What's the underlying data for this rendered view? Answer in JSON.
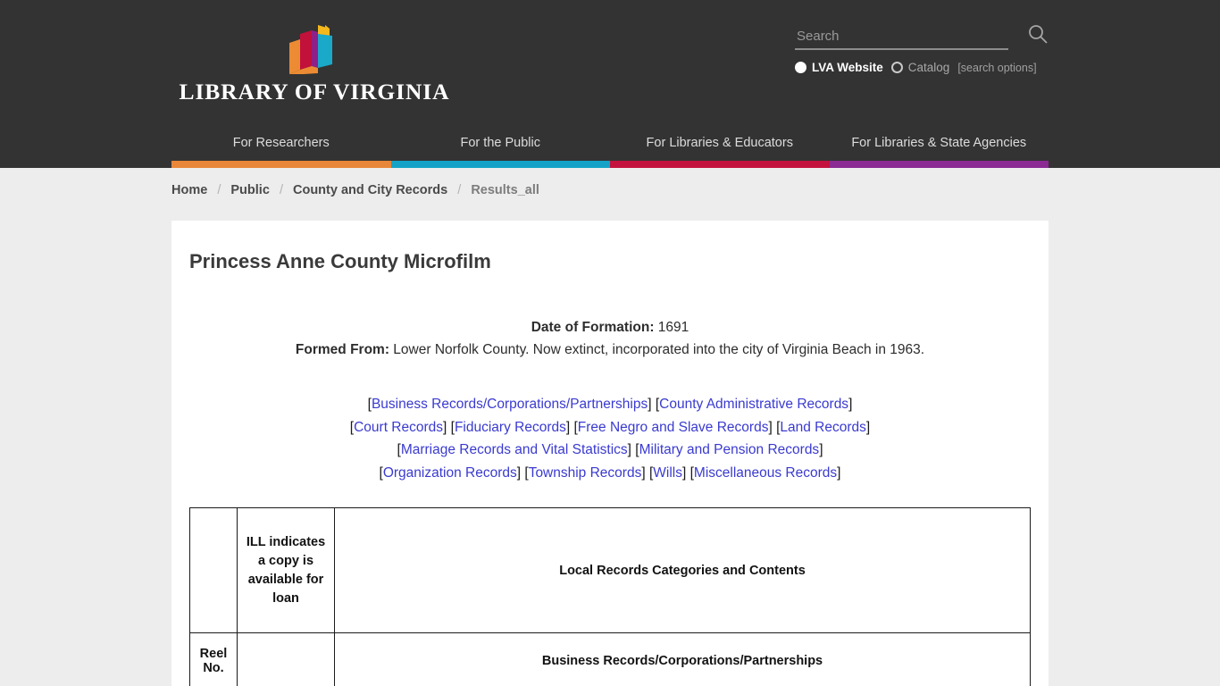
{
  "header": {
    "brand": {
      "wordmark": "LIBRARY OF VIRGINIA",
      "logo_icon": "open-book-logo-icon",
      "colors": {
        "orange": "#ec8b33",
        "crimson": "#c2113a",
        "purple": "#8e2088",
        "yellow": "#f5b81c",
        "cyan": "#1aa9c8"
      }
    },
    "search": {
      "placeholder": "Search",
      "value": "",
      "submit_icon": "search-icon",
      "scopes": [
        {
          "label": "LVA Website",
          "selected": true
        },
        {
          "label": "Catalog",
          "selected": false
        }
      ],
      "options_link": "[search options]"
    },
    "nav": {
      "items": [
        {
          "label": "For Researchers",
          "accent": "#e8873a"
        },
        {
          "label": "For the Public",
          "accent": "#14a3c7"
        },
        {
          "label": "For Libraries & Educators",
          "accent": "#c4123e"
        },
        {
          "label": "For Libraries & State Agencies",
          "accent": "#8b2a93"
        }
      ]
    },
    "background_color": "#333333"
  },
  "breadcrumb": {
    "separator": "/",
    "items": [
      {
        "label": "Home",
        "current": false
      },
      {
        "label": "Public",
        "current": false
      },
      {
        "label": "County and City Records",
        "current": false
      },
      {
        "label": "Results_all",
        "current": true
      }
    ]
  },
  "main": {
    "page_title": "Princess Anne County Microfilm",
    "meta": {
      "formation_label": "Date of Formation:",
      "formation_value": "1691",
      "formed_from_label": "Formed From:",
      "formed_from_value": "Lower Norfolk County. Now extinct, incorporated into the city of Virginia Beach in 1963."
    },
    "category_links": [
      "Business Records/Corporations/Partnerships",
      "County Administrative Records",
      "Court Records",
      "Fiduciary Records",
      "Free Negro and Slave Records",
      "Land Records",
      "Marriage Records and Vital Statistics",
      "Military and Pension Records",
      "Organization Records",
      "Township Records",
      "Wills",
      "Miscellaneous Records"
    ],
    "link_color": "#3a3ad0",
    "table": {
      "header": {
        "col1": "",
        "col2": "ILL indicates a copy is available for loan",
        "col3": "Local Records Categories and Contents"
      },
      "rows": [
        {
          "col1": "Reel No.",
          "col2": "",
          "col3": "Business Records/Corporations/Partnerships"
        }
      ]
    }
  }
}
